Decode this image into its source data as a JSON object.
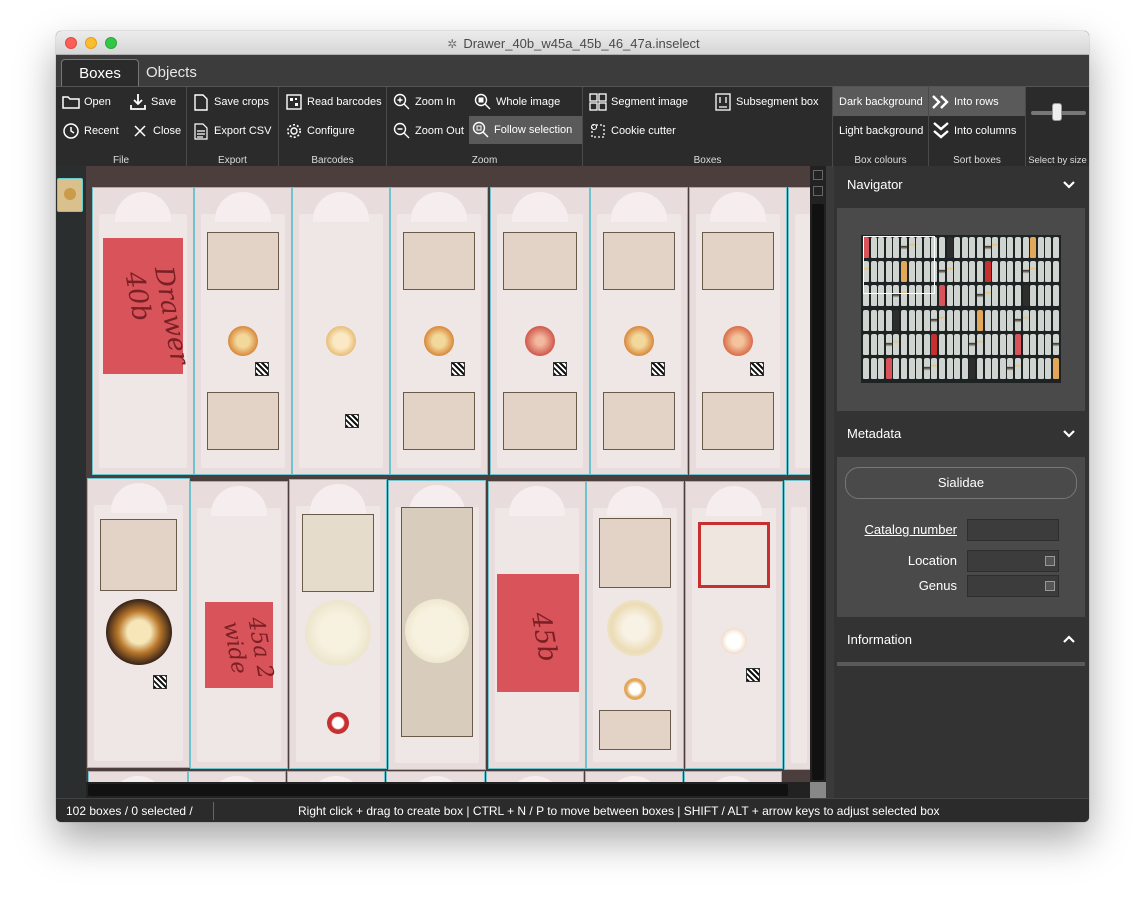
{
  "window": {
    "title": "Drawer_40b_w45a_45b_46_47a.inselect"
  },
  "tabs": [
    {
      "label": "Boxes"
    },
    {
      "label": "Objects"
    }
  ],
  "ribbon": {
    "file": {
      "label": "File",
      "open": "Open",
      "save": "Save",
      "recent": "Recent",
      "close": "Close"
    },
    "export": {
      "label": "Export",
      "save_crops": "Save crops",
      "export_csv": "Export CSV"
    },
    "barcodes": {
      "label": "Barcodes",
      "read": "Read barcodes",
      "configure": "Configure"
    },
    "zoom": {
      "label": "Zoom",
      "zoom_in": "Zoom In",
      "zoom_out": "Zoom Out",
      "whole_image": "Whole image",
      "follow_selection": "Follow selection"
    },
    "boxes": {
      "label": "Boxes",
      "segment": "Segment image",
      "subsegment": "Subsegment box",
      "cookie": "Cookie cutter"
    },
    "box_colours": {
      "label": "Box colours",
      "dark": "Dark background",
      "light": "Light background"
    },
    "sort_boxes": {
      "label": "Sort boxes",
      "rows": "Into rows",
      "columns": "Into columns"
    },
    "select_by_size": {
      "label": "Select by size",
      "slider_value": 0.5
    }
  },
  "slides_text": {
    "red1": "Drawer 40b",
    "red2": "45a 2 wide",
    "red3": "45b"
  },
  "panel": {
    "navigator": {
      "title": "Navigator",
      "chevron": "chevron-down"
    },
    "metadata": {
      "title": "Metadata",
      "family": "Sialidae",
      "catalog_label": "Catalog number",
      "location_label": "Location",
      "genus_label": "Genus",
      "catalog_value": "",
      "location_value": "",
      "genus_value": ""
    },
    "information": {
      "title": "Information",
      "chevron": "chevron-up"
    }
  },
  "status": {
    "left": "102 boxes / 0 selected /",
    "hint": "Right click + drag to create box  |  CTRL + N / P to move between boxes  |  SHIFT / ALT + arrow keys to adjust selected box"
  }
}
